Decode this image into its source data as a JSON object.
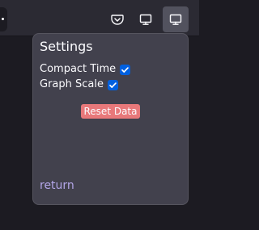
{
  "toolbar": {
    "buttons": [
      {
        "icon": "pocket-icon"
      },
      {
        "icon": "monitor-icon"
      },
      {
        "icon": "monitor-icon",
        "state": "active"
      }
    ]
  },
  "popup": {
    "title": "Settings",
    "options": [
      {
        "label": "Compact Time",
        "checked": true
      },
      {
        "label": "Graph Scale",
        "checked": true
      }
    ],
    "reset_label": "Reset Data",
    "return_label": "return"
  },
  "colors": {
    "accent": "#0060df",
    "reset": "#e8787a",
    "link": "#b3a6e8",
    "popup_bg": "#42414d"
  }
}
